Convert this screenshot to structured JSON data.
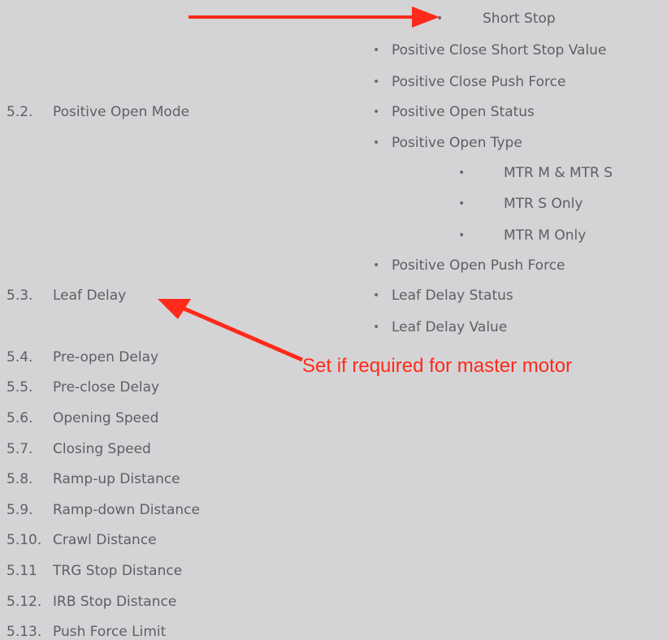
{
  "left_list": [
    {
      "num": "5.2.",
      "label": "Positive Open Mode"
    },
    {
      "num": "5.3.",
      "label": "Leaf Delay"
    },
    {
      "num": "5.4.",
      "label": "Pre-open Delay"
    },
    {
      "num": "5.5.",
      "label": "Pre-close Delay"
    },
    {
      "num": "5.6.",
      "label": "Opening Speed"
    },
    {
      "num": "5.7.",
      "label": "Closing Speed"
    },
    {
      "num": "5.8.",
      "label": "Ramp-up Distance"
    },
    {
      "num": "5.9.",
      "label": "Ramp-down Distance"
    },
    {
      "num": "5.10.",
      "label": "Crawl Distance"
    },
    {
      "num": "5.11",
      "label": "TRG Stop Distance"
    },
    {
      "num": "5.12.",
      "label": "IRB Stop Distance"
    },
    {
      "num": "5.13.",
      "label": "Push Force Limit"
    }
  ],
  "right_list": {
    "short_stop": "Short Stop",
    "items": [
      "Positive Close Short Stop Value",
      "Positive Close Push Force",
      "Positive Open Status",
      "Positive Open Type"
    ],
    "sub_items": [
      "MTR M & MTR S",
      "MTR S Only",
      "MTR M Only"
    ],
    "items_after": [
      "Positive Open Push Force",
      "Leaf Delay Status",
      "Leaf Delay Value"
    ]
  },
  "annotation": {
    "text": "Set if required for master motor",
    "color": "#ff2a1a"
  },
  "colors": {
    "background": "#d4d4d6",
    "text": "#5f5f63"
  }
}
